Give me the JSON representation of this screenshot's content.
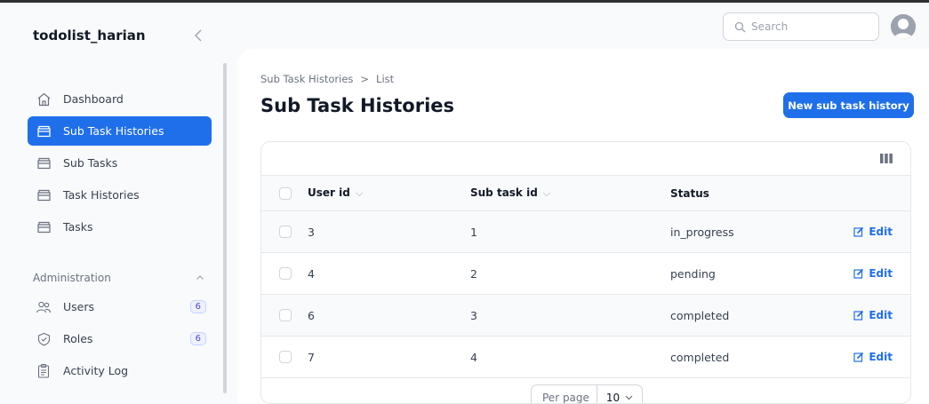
{
  "app": {
    "title": "todolist_harian",
    "collapse_glyph": "‹"
  },
  "sidebar": {
    "items": [
      {
        "label": "Dashboard",
        "icon": "home-icon",
        "active": false
      },
      {
        "label": "Sub Task Histories",
        "icon": "folder-icon",
        "active": true
      },
      {
        "label": "Sub Tasks",
        "icon": "folder-icon",
        "active": false
      },
      {
        "label": "Task Histories",
        "icon": "folder-icon",
        "active": false
      },
      {
        "label": "Tasks",
        "icon": "folder-icon",
        "active": false
      }
    ],
    "group": {
      "label": "Administration",
      "items": [
        {
          "label": "Users",
          "icon": "users-icon",
          "badge": "6"
        },
        {
          "label": "Roles",
          "icon": "shield-check-icon",
          "badge": "6"
        },
        {
          "label": "Activity Log",
          "icon": "clipboard-icon",
          "badge": ""
        }
      ]
    }
  },
  "search": {
    "placeholder": "Search"
  },
  "breadcrumb": {
    "parent": "Sub Task Histories",
    "separator": ">",
    "current": "List"
  },
  "page": {
    "title": "Sub Task Histories",
    "new_button": "New sub task history"
  },
  "table": {
    "columns": {
      "user_id": "User id",
      "sub_task_id": "Sub task id",
      "status": "Status"
    },
    "rows": [
      {
        "user_id": "3",
        "sub_task_id": "1",
        "status": "in_progress",
        "action": "Edit"
      },
      {
        "user_id": "4",
        "sub_task_id": "2",
        "status": "pending",
        "action": "Edit"
      },
      {
        "user_id": "6",
        "sub_task_id": "3",
        "status": "completed",
        "action": "Edit"
      },
      {
        "user_id": "7",
        "sub_task_id": "4",
        "status": "completed",
        "action": "Edit"
      }
    ]
  },
  "pagination": {
    "per_page_label": "Per page",
    "per_page_value": "10"
  },
  "colors": {
    "accent": "#1f6feb",
    "badge_text": "#4f46e5"
  }
}
